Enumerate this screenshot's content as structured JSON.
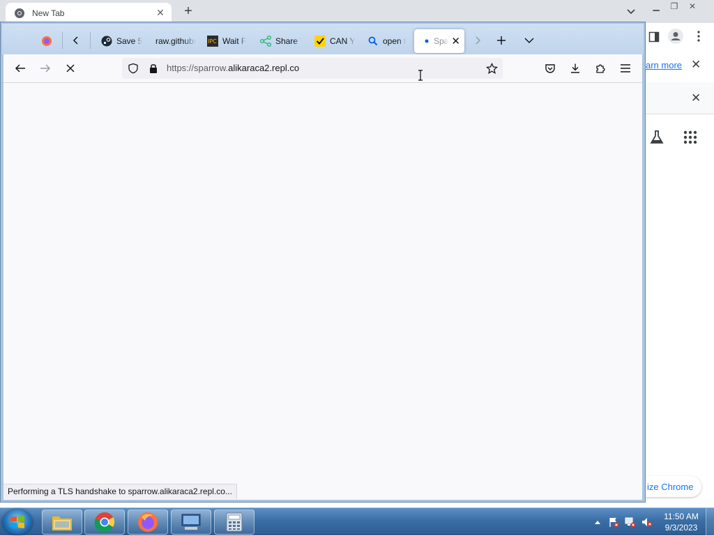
{
  "chrome": {
    "tab_title": "New Tab",
    "learn_more": "arn more",
    "customize": "ize Chrome"
  },
  "firefox": {
    "tabs": [
      {
        "label": "",
        "icon": "firefox-view-icon"
      },
      {
        "label": "Save 5",
        "icon": "steam-icon"
      },
      {
        "label": "raw.githubu",
        "icon": ""
      },
      {
        "label": "Wait F",
        "icon": "ipc-icon"
      },
      {
        "label": "Share T",
        "icon": "share-icon"
      },
      {
        "label": "CAN Y",
        "icon": "check-icon"
      },
      {
        "label": "open t",
        "icon": "search-icon"
      },
      {
        "label": "Spa",
        "icon": "loading-dot-icon"
      }
    ],
    "url_prefix": "https://sparrow.",
    "url_domain": "alikaraca2.repl.co",
    "status_text": "Performing a TLS handshake to sparrow.alikaraca2.repl.co...",
    "accent_color": "#0060df"
  },
  "taskbar": {
    "time": "11:50 AM",
    "date": "9/3/2023"
  }
}
